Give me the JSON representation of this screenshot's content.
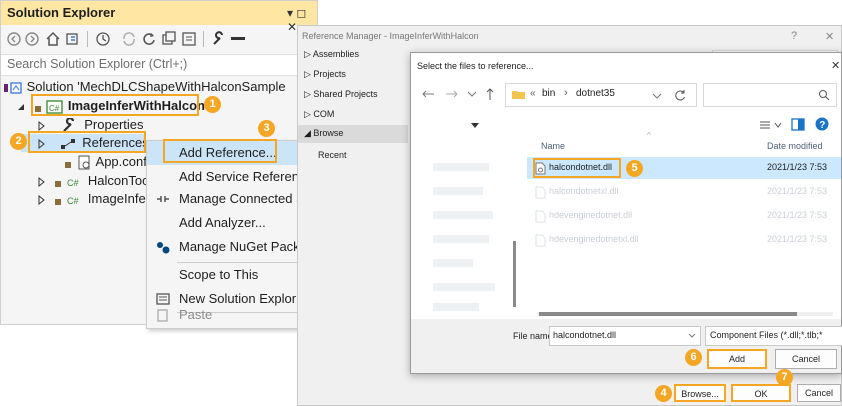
{
  "solution_explorer": {
    "title": "Solution Explorer",
    "title_controls": "▾ ◻ ✕",
    "search_placeholder": "Search Solution Explorer (Ctrl+;)",
    "tree": {
      "solution": "Solution 'MechDLCShapeWithHalconSample",
      "project": "ImageInferWithHalcon",
      "properties": "Properties",
      "references": "References",
      "app_config": "App.config",
      "halcon_tool": "HalconTool",
      "image_infer": "ImageInferV"
    }
  },
  "context_menu": {
    "items": [
      {
        "label": "Add Reference..."
      },
      {
        "label": "Add Service Referen"
      },
      {
        "label": "Manage Connected S"
      },
      {
        "label": "Add Analyzer..."
      },
      {
        "label": "Manage NuGet Packa"
      },
      {
        "label": "Scope to This"
      },
      {
        "label": "New Solution Explor"
      },
      {
        "label": "Paste"
      }
    ]
  },
  "reference_manager": {
    "title": "Reference Manager - ImageInferWithHalcon",
    "help": "?",
    "close": "✕",
    "nav": {
      "assemblies": "▷ Assemblies",
      "projects": "▷ Projects",
      "shared_projects": "▷ Shared Projects",
      "com": "▷ COM",
      "browse": "◢ Browse",
      "recent": "Recent"
    },
    "buttons": {
      "browse": "Browse...",
      "ok": "OK",
      "cancel": "Cancel"
    }
  },
  "file_dialog": {
    "title": "Select the files to reference...",
    "close": "✕",
    "breadcrumb": {
      "prefix": "«",
      "bin": "bin",
      "sep": "›",
      "folder": "dotnet35"
    },
    "columns": {
      "name": "Name",
      "date": "Date modified"
    },
    "files": [
      {
        "name": "halcondotnet.dll",
        "date": "2021/1/23 7:53"
      },
      {
        "name": "halcondotnetxl.dll",
        "date": "2021/1/23 7:53"
      },
      {
        "name": "hdevenginedotnet.dll",
        "date": "2021/1/23 7:53"
      },
      {
        "name": "hdevenginedotnetxl.dll",
        "date": "2021/1/23 7:53"
      }
    ],
    "file_name_label": "File name:",
    "file_name_value": "halcondotnet.dll",
    "file_type": "Component Files (*.dll;*.tlb;*",
    "add": "Add",
    "cancel": "Cancel"
  },
  "callouts": [
    "1",
    "2",
    "3",
    "4",
    "5",
    "6",
    "7"
  ],
  "colors": {
    "accent": "#f5a623",
    "selection": "#cce4f7",
    "title_bar": "#eeeef2"
  }
}
